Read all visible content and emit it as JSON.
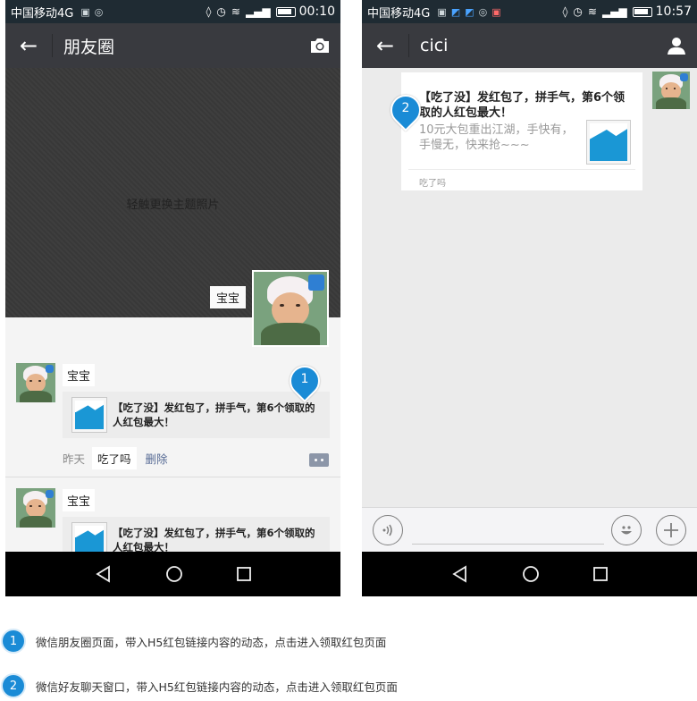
{
  "phone1": {
    "status": {
      "carrier": "中国移动4G",
      "time": "00:10"
    },
    "nav": {
      "title": "朋友圈",
      "right_icon": "camera-icon"
    },
    "cover": {
      "hint": "轻触更换主题照片",
      "username": "宝宝"
    },
    "posts": [
      {
        "name": "宝宝",
        "card_title": "【吃了没】发红包了，拼手气，第6个领取的人红包最大！",
        "time": "昨天",
        "caption": "吃了吗",
        "delete": "删除"
      },
      {
        "name": "宝宝",
        "card_title": "【吃了没】发红包了，拼手气，第6个领取的人红包最大！"
      }
    ],
    "pin": "1"
  },
  "phone2": {
    "status": {
      "carrier": "中国移动4G",
      "time": "10:57"
    },
    "nav": {
      "title": "cici",
      "right_icon": "contact-icon"
    },
    "message": {
      "title": "【吃了没】发红包了，拼手气，第6个领取的人红包最大！",
      "desc": "10元大包重出江湖，手快有，手慢无，快来抢~~~",
      "source": "吃了吗"
    },
    "pin": "2"
  },
  "legend": [
    {
      "num": "1",
      "text": "微信朋友圈页面，带入H5红包链接内容的动态，点击进入领取红包页面"
    },
    {
      "num": "2",
      "text": "微信好友聊天窗口，带入H5红包链接内容的动态，点击进入领取红包页面"
    }
  ],
  "colors": {
    "status_bar": "#1f2b33",
    "nav_bar": "#393a3f",
    "pin_blue": "#1a8bd6",
    "link_blue": "#576b95"
  }
}
